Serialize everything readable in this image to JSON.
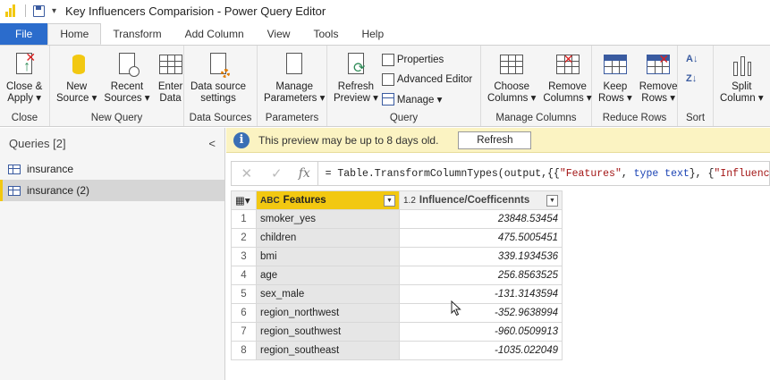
{
  "window": {
    "title": "Key Influencers Comparision - Power Query Editor"
  },
  "tabs": [
    "File",
    "Home",
    "Transform",
    "Add Column",
    "View",
    "Tools",
    "Help"
  ],
  "active_tab": "Home",
  "ribbon": {
    "close": {
      "label": "Close",
      "close_apply": "Close &\nApply ▾"
    },
    "new_query": {
      "label": "New Query",
      "new_source": "New\nSource ▾",
      "recent_sources": "Recent\nSources ▾",
      "enter_data": "Enter\nData"
    },
    "data_sources": {
      "label": "Data Sources",
      "settings": "Data source\nsettings"
    },
    "parameters": {
      "label": "Parameters",
      "manage": "Manage\nParameters ▾"
    },
    "query": {
      "label": "Query",
      "refresh": "Refresh\nPreview ▾",
      "properties": "Properties",
      "advanced_editor": "Advanced Editor",
      "manage": "Manage ▾"
    },
    "manage_columns": {
      "label": "Manage Columns",
      "choose": "Choose\nColumns ▾",
      "remove": "Remove\nColumns ▾"
    },
    "reduce_rows": {
      "label": "Reduce Rows",
      "keep": "Keep\nRows ▾",
      "remove": "Remove\nRows ▾"
    },
    "sort": {
      "label": "Sort"
    },
    "transform": {
      "split": "Split\nColumn ▾"
    }
  },
  "queries": {
    "header": "Queries [2]",
    "items": [
      {
        "label": "insurance",
        "selected": false
      },
      {
        "label": "insurance (2)",
        "selected": true
      }
    ]
  },
  "infobar": {
    "message": "This preview may be up to 8 days old.",
    "button": "Refresh"
  },
  "formula": {
    "prefix": "= Table.TransformColumnTypes(output,{{",
    "s1": "\"Features\"",
    "mid1": ", ",
    "kw1": "type",
    "mid2": " ",
    "kw2": "text",
    "mid3": "}, {",
    "s2": "\"Influence"
  },
  "table": {
    "columns": [
      {
        "type": "ABC",
        "name": "Features"
      },
      {
        "type": "1.2",
        "name": "Influence/Coefficennts"
      }
    ],
    "rows": [
      {
        "n": "1",
        "feature": "smoker_yes",
        "value": "23848.53454"
      },
      {
        "n": "2",
        "feature": "children",
        "value": "475.5005451"
      },
      {
        "n": "3",
        "feature": "bmi",
        "value": "339.1934536"
      },
      {
        "n": "4",
        "feature": "age",
        "value": "256.8563525"
      },
      {
        "n": "5",
        "feature": "sex_male",
        "value": "-131.3143594"
      },
      {
        "n": "6",
        "feature": "region_northwest",
        "value": "-352.9638994"
      },
      {
        "n": "7",
        "feature": "region_southwest",
        "value": "-960.0509913"
      },
      {
        "n": "8",
        "feature": "region_southeast",
        "value": "-1035.022049"
      }
    ]
  }
}
